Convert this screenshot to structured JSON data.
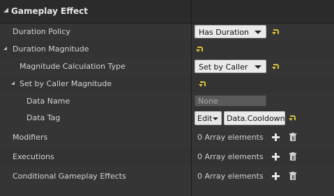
{
  "header": {
    "title": "Gameplay Effect"
  },
  "rows": {
    "duration_policy": {
      "label": "Duration Policy",
      "value": "Has Duration"
    },
    "duration_magnitude": {
      "label": "Duration Magnitude"
    },
    "magnitude_calc_type": {
      "label": "Magnitude Calculation Type",
      "value": "Set by Caller"
    },
    "set_by_caller_magnitude": {
      "label": "Set by Caller Magnitude"
    },
    "data_name": {
      "label": "Data Name",
      "value": "None"
    },
    "data_tag": {
      "label": "Data Tag",
      "edit_label": "Edit",
      "value": "Data.Cooldown"
    },
    "modifiers": {
      "label": "Modifiers",
      "value": "0 Array elements"
    },
    "executions": {
      "label": "Executions",
      "value": "0 Array elements"
    },
    "conditional_effects": {
      "label": "Conditional Gameplay Effects",
      "value": "0 Array elements"
    }
  },
  "icons": {
    "expand": "triangle-expanded-icon",
    "reset": "reset-to-default-icon",
    "add": "plus-icon",
    "delete": "trash-icon"
  },
  "colors": {
    "reset_arrow": "#d8c33a",
    "panel_bg": "#353535",
    "header_bg": "#2b2b2b"
  }
}
